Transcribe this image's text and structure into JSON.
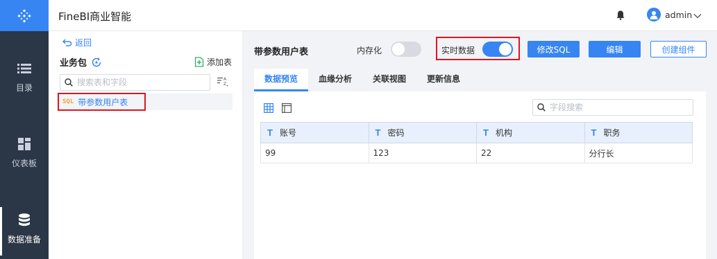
{
  "app": {
    "title": "FineBI商业智能",
    "user": "admin"
  },
  "nav": [
    {
      "label": "目录",
      "icon": "list-icon"
    },
    {
      "label": "仪表板",
      "icon": "dashboard-icon"
    },
    {
      "label": "数据准备",
      "icon": "database-icon",
      "active": true
    }
  ],
  "left_panel": {
    "back": "返回",
    "title": "业务包",
    "add_table": "添加表",
    "search_placeholder": "搜索表和字段",
    "tree": [
      {
        "tag": "SQL",
        "label": "带参数用户表",
        "selected": true
      }
    ]
  },
  "right_panel": {
    "table_name": "带参数用户表",
    "in_memory_label": "内存化",
    "in_memory_on": false,
    "realtime_label": "实时数据",
    "realtime_on": true,
    "buttons": {
      "edit_sql": "修改SQL",
      "edit": "编辑",
      "create_component": "创建组件"
    },
    "tabs": [
      "数据预览",
      "血缘分析",
      "关联视图",
      "更新信息"
    ],
    "active_tab": 0,
    "field_search_placeholder": "字段搜索",
    "table": {
      "columns": [
        {
          "type": "T",
          "name": "账号"
        },
        {
          "type": "T",
          "name": "密码"
        },
        {
          "type": "T",
          "name": "机构"
        },
        {
          "type": "T",
          "name": "职务"
        }
      ],
      "rows": [
        [
          "99",
          "123",
          "22",
          "分行长"
        ]
      ]
    }
  },
  "colors": {
    "accent": "#3685f2",
    "nav_bg": "#2b3646",
    "highlight": "#e0141e"
  }
}
